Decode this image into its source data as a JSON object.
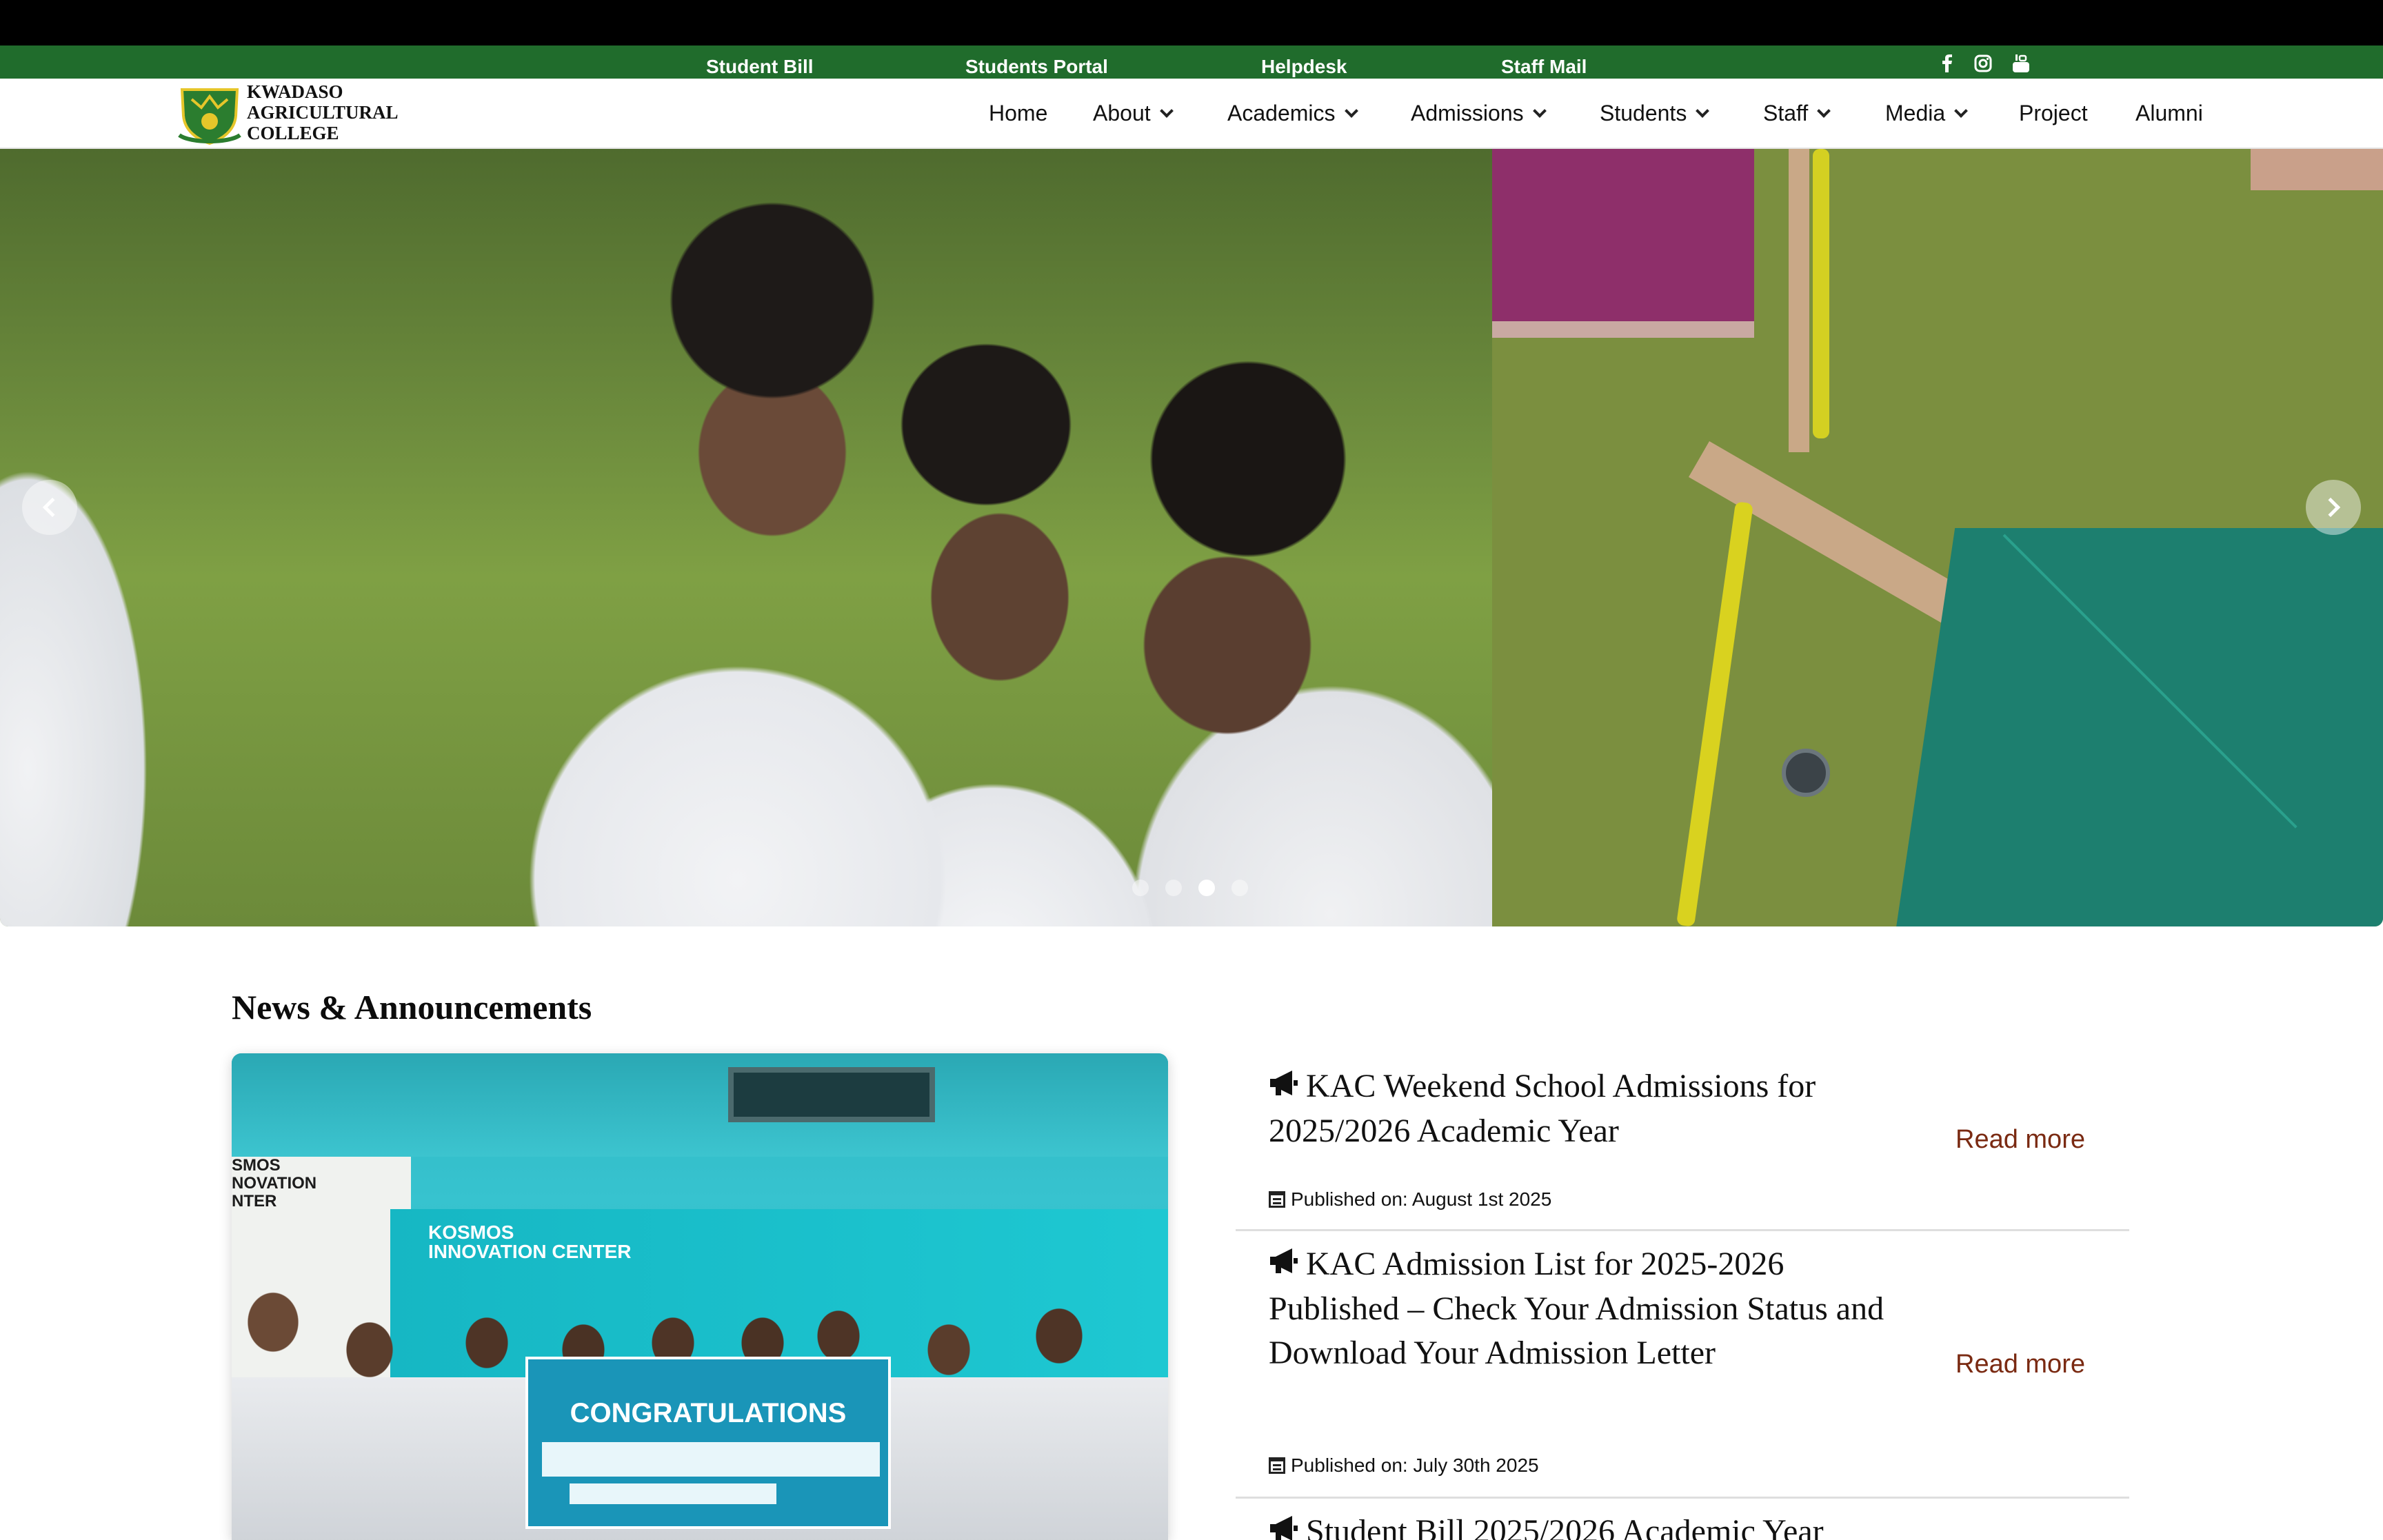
{
  "utility_bar": {
    "links": [
      "Student Bill",
      "Students Portal",
      "Helpdesk",
      "Staff Mail"
    ],
    "social_icons": [
      "facebook-icon",
      "instagram-icon",
      "youtube-icon"
    ],
    "background": "#206c2c"
  },
  "brand": {
    "line1": "KWADASO",
    "line2": "AGRICULTURAL",
    "line3": "COLLEGE"
  },
  "nav": {
    "home": "Home",
    "about": "About",
    "academics": "Academics",
    "admissions": "Admissions",
    "students": "Students",
    "staff": "Staff",
    "media": "Media",
    "project": "Project",
    "alumni": "Alumni"
  },
  "carousel": {
    "slide_count": 4,
    "active_slide": 3
  },
  "news": {
    "section_title": "News & Announcements",
    "feature_image": {
      "banner_left_text": "SMOS NOVATION NTER",
      "banner_text": "KOSMOS INNOVATION CENTER",
      "check_title": "CONGRATULATIONS"
    },
    "items": [
      {
        "title": "KAC Weekend School Admissions for 2025/2026 Academic Year",
        "read_more": "Read more",
        "published": "Published on: August 1st 2025"
      },
      {
        "title": "KAC Admission List for 2025-2026 Published – Check Your Admission Status and Download Your Admission Letter",
        "read_more": "Read more",
        "published": "Published on: July 30th 2025"
      },
      {
        "title": "Student Bill 2025/2026 Academic Year",
        "read_more": "",
        "published": ""
      }
    ],
    "read_more_color": "#7a2a12"
  }
}
